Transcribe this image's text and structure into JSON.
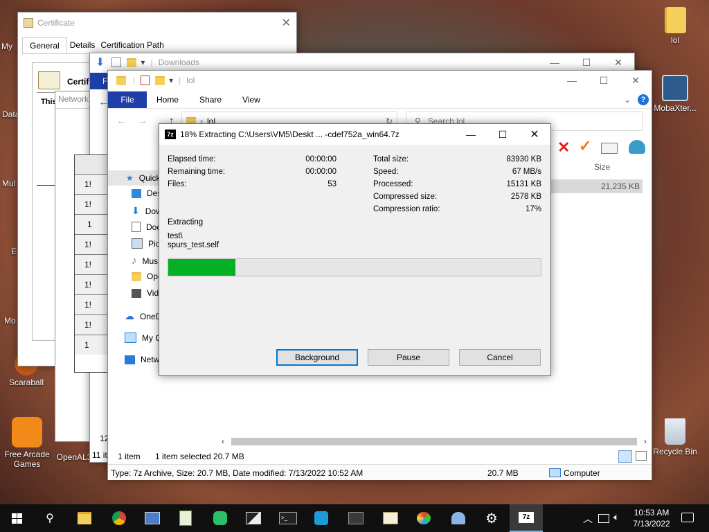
{
  "desktop": {
    "icons": [
      {
        "label": "lol"
      },
      {
        "label": "MobaXter..."
      },
      {
        "label": "Scaraball"
      },
      {
        "label": "Free Arcade Games"
      },
      {
        "label": "OpenAL3"
      },
      {
        "label": "Recycle Bin"
      }
    ],
    "partial_labels": [
      "My",
      "Data",
      "Mul",
      "E",
      "Mo"
    ]
  },
  "cert_window": {
    "title": "Certificate",
    "tabs": [
      "General",
      "Details",
      "Certification Path"
    ],
    "heading_partial": "Certif",
    "text_partial": "This",
    "network_partial": "Network"
  },
  "downloads_window": {
    "title": "Downloads",
    "file_tab_partial": "F",
    "left_numbers": [
      "1!",
      "1!",
      "1",
      "1!",
      "1!",
      "1!",
      "1!",
      "1!",
      "1"
    ],
    "status_partial": [
      "12",
      "11 it"
    ]
  },
  "explorer": {
    "title": "lol",
    "ribbon_tabs": [
      "File",
      "Home",
      "Share",
      "View"
    ],
    "address": "lol",
    "search_placeholder": "Search lol",
    "nav": [
      {
        "label": "Quick",
        "icon": "star-icon"
      },
      {
        "label": "Desk",
        "icon": "desktop-icon"
      },
      {
        "label": "Dow",
        "icon": "download-icon"
      },
      {
        "label": "Doc",
        "icon": "document-icon"
      },
      {
        "label": "Pict",
        "icon": "picture-icon"
      },
      {
        "label": "Mus",
        "icon": "music-icon"
      },
      {
        "label": "Ope",
        "icon": "folder-icon"
      },
      {
        "label": "Vide",
        "icon": "video-icon"
      },
      {
        "label": "OneD",
        "icon": "cloud-icon"
      },
      {
        "label": "My C",
        "icon": "computer-icon"
      },
      {
        "label": "Netw",
        "icon": "network-icon"
      }
    ],
    "size_header": "Size",
    "row_size": "21,235 KB",
    "status_left": "1 item",
    "status_selected": "1 item selected  20.7 MB",
    "details_bar": "Type: 7z Archive, Size: 20.7 MB, Date modified: 7/13/2022 10:52 AM",
    "details_size": "20.7 MB",
    "details_location": "Computer"
  },
  "extract_dialog": {
    "title": "18% Extracting C:\\Users\\VM5\\Deskt ... -cdef752a_win64.7z",
    "progress_percent": 18,
    "left": [
      {
        "label": "Elapsed time:",
        "value": "00:00:00"
      },
      {
        "label": "Remaining time:",
        "value": "00:00:00"
      },
      {
        "label": "Files:",
        "value": "53"
      }
    ],
    "right": [
      {
        "label": "Total size:",
        "value": "83930 KB"
      },
      {
        "label": "Speed:",
        "value": "67 MB/s"
      },
      {
        "label": "Processed:",
        "value": "15131 KB"
      },
      {
        "label": "Compressed size:",
        "value": "2578 KB"
      },
      {
        "label": "Compression ratio:",
        "value": "17%"
      }
    ],
    "status_label": "Extracting",
    "path_line1": "test\\",
    "path_line2": "spurs_test.self",
    "buttons": {
      "background": "Background",
      "pause": "Pause",
      "cancel": "Cancel"
    }
  },
  "taskbar": {
    "time": "10:53 AM",
    "date": "7/13/2022",
    "active_app_label": "7z"
  },
  "colors": {
    "progress_green": "#06b025",
    "file_tab_blue": "#1e3fa8",
    "taskbar_bg": "#101010"
  }
}
